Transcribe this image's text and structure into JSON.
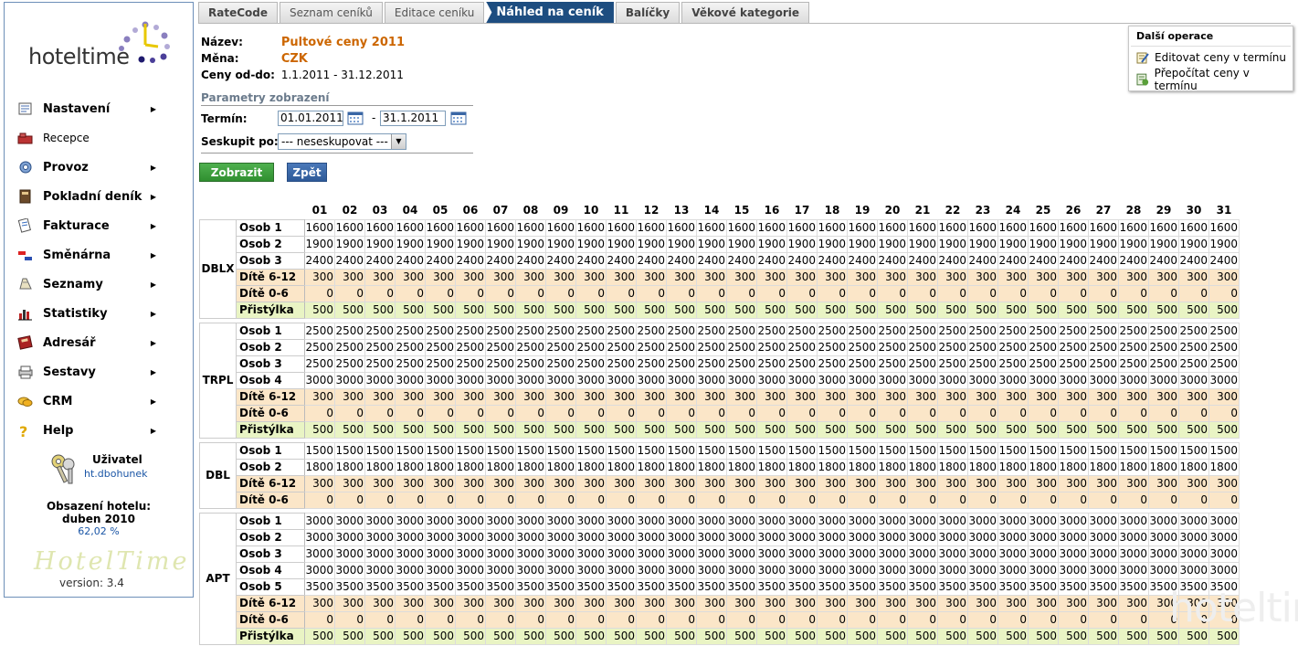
{
  "sidebar": {
    "logo_text": "hoteltime",
    "menu": [
      {
        "label": "Nastavení",
        "icon": "settings-icon",
        "has_submenu": true,
        "bold": true
      },
      {
        "label": "Recepce",
        "icon": "reception-icon",
        "has_submenu": false,
        "bold": false
      },
      {
        "label": "Provoz",
        "icon": "operations-icon",
        "has_submenu": true,
        "bold": true
      },
      {
        "label": "Pokladní deník",
        "icon": "cash-book-icon",
        "has_submenu": true,
        "bold": true
      },
      {
        "label": "Fakturace",
        "icon": "invoicing-icon",
        "has_submenu": true,
        "bold": true
      },
      {
        "label": "Směnárna",
        "icon": "exchange-icon",
        "has_submenu": true,
        "bold": true
      },
      {
        "label": "Seznamy",
        "icon": "lists-icon",
        "has_submenu": true,
        "bold": true
      },
      {
        "label": "Statistiky",
        "icon": "statistics-icon",
        "has_submenu": true,
        "bold": true
      },
      {
        "label": "Adresář",
        "icon": "address-book-icon",
        "has_submenu": true,
        "bold": true
      },
      {
        "label": "Sestavy",
        "icon": "reports-icon",
        "has_submenu": true,
        "bold": true
      },
      {
        "label": "CRM",
        "icon": "crm-icon",
        "has_submenu": true,
        "bold": true
      },
      {
        "label": "Help",
        "icon": "help-icon",
        "has_submenu": true,
        "bold": true
      }
    ],
    "user": {
      "title": "Uživatel",
      "name": "ht.dbohunek"
    },
    "occupancy": {
      "title_line1": "Obsazení hotelu:",
      "title_line2": "duben 2010",
      "value": "62,02 %"
    },
    "small_logo_text": "HotelTime",
    "version": "version: 3.4"
  },
  "tabs": [
    {
      "label": "RateCode",
      "bold": true,
      "active": false
    },
    {
      "label": "Seznam ceníků",
      "bold": false,
      "active": false
    },
    {
      "label": "Editace ceníku",
      "bold": false,
      "active": false
    },
    {
      "label": "Náhled na ceník",
      "bold": true,
      "active": true
    },
    {
      "label": "Balíčky",
      "bold": true,
      "active": false
    },
    {
      "label": "Věkové kategorie",
      "bold": true,
      "active": false
    }
  ],
  "info": {
    "name_label": "Název:",
    "name_value": "Pultové ceny 2011",
    "currency_label": "Měna:",
    "currency_value": "CZK",
    "range_label": "Ceny od-do:",
    "range_value": "1.1.2011 - 31.12.2011"
  },
  "params": {
    "title": "Parametry zobrazení",
    "term_label": "Termín:",
    "date_from": "01.01.2011",
    "date_sep": "-",
    "date_to": "31.1.2011",
    "group_label": "Seskupit po:",
    "group_value": "--- neseskupovat ---"
  },
  "buttons": {
    "show": "Zobrazit",
    "back": "Zpět"
  },
  "ops": {
    "title": "Další operace",
    "items": [
      {
        "label": "Editovat ceny v termínu",
        "icon": "edit-prices-icon"
      },
      {
        "label": "Přepočítat ceny v termínu",
        "icon": "recalculate-icon"
      }
    ]
  },
  "price_table": {
    "days": [
      "01",
      "02",
      "03",
      "04",
      "05",
      "06",
      "07",
      "08",
      "09",
      "10",
      "11",
      "12",
      "13",
      "14",
      "15",
      "16",
      "17",
      "18",
      "19",
      "20",
      "21",
      "22",
      "23",
      "24",
      "25",
      "26",
      "27",
      "28",
      "29",
      "30",
      "31"
    ],
    "groups": [
      {
        "room": "DBLX",
        "rows": [
          {
            "label": "Osob 1",
            "type": "osob",
            "value": "1600"
          },
          {
            "label": "Osob 2",
            "type": "osob",
            "value": "1900"
          },
          {
            "label": "Osob 3",
            "type": "osob",
            "value": "2400"
          },
          {
            "label": "Dítě 6-12",
            "type": "child",
            "value": "300"
          },
          {
            "label": "Dítě 0-6",
            "type": "child",
            "value": "0"
          },
          {
            "label": "Přistýlka",
            "type": "extra",
            "value": "500"
          }
        ]
      },
      {
        "room": "TRPL",
        "rows": [
          {
            "label": "Osob 1",
            "type": "osob",
            "value": "2500"
          },
          {
            "label": "Osob 2",
            "type": "osob",
            "value": "2500"
          },
          {
            "label": "Osob 3",
            "type": "osob",
            "value": "2500"
          },
          {
            "label": "Osob 4",
            "type": "osob",
            "value": "3000"
          },
          {
            "label": "Dítě 6-12",
            "type": "child",
            "value": "300"
          },
          {
            "label": "Dítě 0-6",
            "type": "child",
            "value": "0"
          },
          {
            "label": "Přistýlka",
            "type": "extra",
            "value": "500"
          }
        ]
      },
      {
        "room": "DBL",
        "rows": [
          {
            "label": "Osob 1",
            "type": "osob",
            "value": "1500"
          },
          {
            "label": "Osob 2",
            "type": "osob",
            "value": "1800"
          },
          {
            "label": "Dítě 6-12",
            "type": "child",
            "value": "300"
          },
          {
            "label": "Dítě 0-6",
            "type": "child",
            "value": "0"
          }
        ]
      },
      {
        "room": "APT",
        "rows": [
          {
            "label": "Osob 1",
            "type": "osob",
            "value": "3000"
          },
          {
            "label": "Osob 2",
            "type": "osob",
            "value": "3000"
          },
          {
            "label": "Osob 3",
            "type": "osob",
            "value": "3000"
          },
          {
            "label": "Osob 4",
            "type": "osob",
            "value": "3000"
          },
          {
            "label": "Osob 5",
            "type": "osob",
            "value": "3500"
          },
          {
            "label": "Dítě 6-12",
            "type": "child",
            "value": "300"
          },
          {
            "label": "Dítě 0-6",
            "type": "child",
            "value": "0"
          },
          {
            "label": "Přistýlka",
            "type": "extra",
            "value": "500"
          }
        ]
      }
    ]
  },
  "watermark_text": "hoteltime"
}
